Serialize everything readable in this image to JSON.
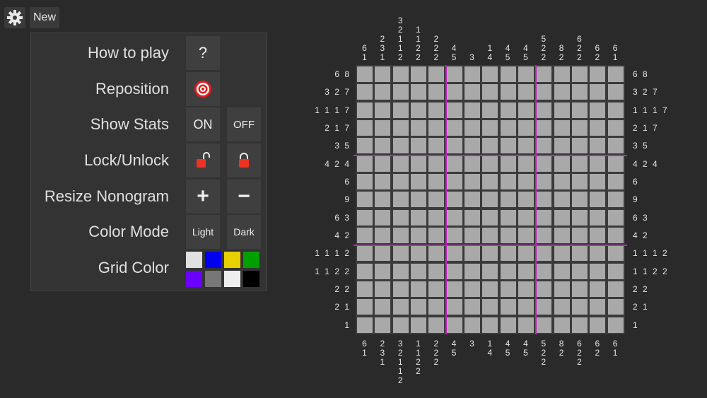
{
  "toolbar": {
    "new_label": "New"
  },
  "settings": {
    "how_to_play": {
      "label": "How to play",
      "button": "?"
    },
    "reposition": {
      "label": "Reposition"
    },
    "show_stats": {
      "label": "Show Stats",
      "on": "ON",
      "off": "OFF"
    },
    "lock_unlock": {
      "label": "Lock/Unlock"
    },
    "resize": {
      "label": "Resize Nonogram",
      "plus": "+",
      "minus": "−"
    },
    "color_mode": {
      "label": "Color Mode",
      "light": "Light",
      "dark": "Dark"
    },
    "grid_color": {
      "label": "Grid Color",
      "swatches": [
        "#e0e0e0",
        "#0000ee",
        "#e8d000",
        "#00a000",
        "#6a00ff",
        "#777777",
        "#eeeeee",
        "#000000"
      ]
    }
  },
  "nonogram": {
    "size": 15,
    "separator_color": "#c41fc4",
    "column_clues": [
      [
        "6",
        "1"
      ],
      [
        "2",
        "3",
        "1"
      ],
      [
        "3",
        "2",
        "1",
        "1",
        "2"
      ],
      [
        "1",
        "1",
        "2",
        "2"
      ],
      [
        "2",
        "2",
        "2"
      ],
      [
        "4",
        "5"
      ],
      [
        "3"
      ],
      [
        "1",
        "4"
      ],
      [
        "4",
        "5"
      ],
      [
        "4",
        "5"
      ],
      [
        "5",
        "2",
        "2"
      ],
      [
        "8",
        "2"
      ],
      [
        "6",
        "2",
        "2"
      ],
      [
        "6",
        "2"
      ],
      [
        "6",
        "1"
      ]
    ],
    "row_clues": [
      "6 8",
      "3 2 7",
      "1 1 1 7",
      "2 1 7",
      "3 5",
      "4 2 4",
      "6",
      "9",
      "6 3",
      "4 2",
      "1 1 1 2",
      "1 1 2 2",
      "2 2",
      "2 1",
      "1"
    ]
  }
}
